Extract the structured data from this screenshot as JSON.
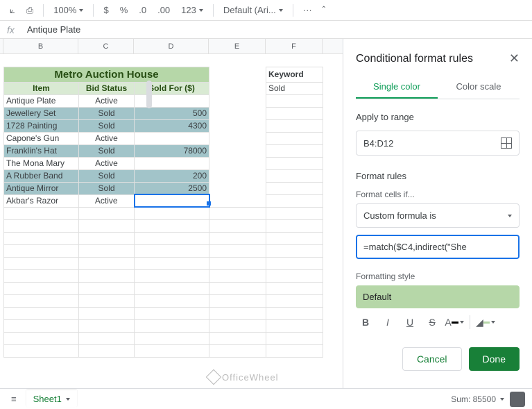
{
  "toolbar": {
    "zoom": "100%",
    "fmt_currency": "$",
    "fmt_percent": "%",
    "fmt_dec_dec": ".0",
    "fmt_dec_inc": ".00",
    "fmt_more": "123",
    "font": "Default (Ari...",
    "more": "···"
  },
  "fx": {
    "label": "fx",
    "value": "Antique Plate"
  },
  "columns": {
    "b": "B",
    "c": "C",
    "d": "D",
    "e": "E",
    "f": "F"
  },
  "table": {
    "title": "Metro Auction House",
    "headers": [
      "Item",
      "Bid Status",
      "Sold For ($)"
    ],
    "rows": [
      {
        "item": "Antique Plate",
        "status": "Active",
        "price": "",
        "sold": false
      },
      {
        "item": "Jewellery Set",
        "status": "Sold",
        "price": "500",
        "sold": true
      },
      {
        "item": "1728 Painting",
        "status": "Sold",
        "price": "4300",
        "sold": true
      },
      {
        "item": "Capone's Gun",
        "status": "Active",
        "price": "",
        "sold": false
      },
      {
        "item": "Franklin's Hat",
        "status": "Sold",
        "price": "78000",
        "sold": true
      },
      {
        "item": "The Mona Mary",
        "status": "Active",
        "price": "",
        "sold": false
      },
      {
        "item": "A Rubber Band",
        "status": "Sold",
        "price": "200",
        "sold": true
      },
      {
        "item": "Antique Mirror",
        "status": "Sold",
        "price": "2500",
        "sold": true
      },
      {
        "item": "Akbar's Razor",
        "status": "Active",
        "price": "",
        "sold": false
      }
    ]
  },
  "keyword": {
    "label": "Keyword",
    "value": "Sold"
  },
  "panel": {
    "title": "Conditional format rules",
    "tab_single": "Single color",
    "tab_scale": "Color scale",
    "apply_label": "Apply to range",
    "range": "B4:D12",
    "rules_label": "Format rules",
    "cells_if": "Format cells if...",
    "condition": "Custom formula is",
    "formula": "=match($C4,indirect(\"She",
    "style_label": "Formatting style",
    "style_preview": "Default",
    "cancel": "Cancel",
    "done": "Done"
  },
  "footer": {
    "sheet": "Sheet1",
    "sum": "Sum: 85500"
  },
  "watermark": "OfficeWheel"
}
